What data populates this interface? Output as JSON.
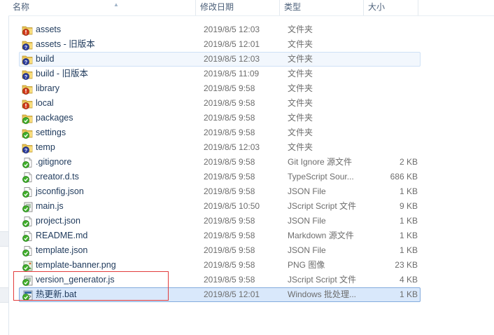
{
  "columns": {
    "name": "名称",
    "date": "修改日期",
    "type": "类型",
    "size": "大小"
  },
  "colors": {
    "selected_bg": "#d9e8fb",
    "annotation": "#e23c3c",
    "git_ok": "#3fae2a",
    "git_modified": "#d23a1a",
    "git_unknown": "#2c3c9c"
  },
  "files": [
    {
      "name": "assets",
      "date": "2019/8/5 12:03",
      "type": "文件夹",
      "size": "",
      "icon": "folder-modified-icon"
    },
    {
      "name": "assets - 旧版本",
      "date": "2019/8/5 12:01",
      "type": "文件夹",
      "size": "",
      "icon": "folder-unversioned-icon"
    },
    {
      "name": "build",
      "date": "2019/8/5 12:03",
      "type": "文件夹",
      "size": "",
      "icon": "folder-unversioned-icon"
    },
    {
      "name": "build - 旧版本",
      "date": "2019/8/5 11:09",
      "type": "文件夹",
      "size": "",
      "icon": "folder-unversioned-icon"
    },
    {
      "name": "library",
      "date": "2019/8/5 9:58",
      "type": "文件夹",
      "size": "",
      "icon": "folder-modified-icon"
    },
    {
      "name": "local",
      "date": "2019/8/5 9:58",
      "type": "文件夹",
      "size": "",
      "icon": "folder-modified-icon"
    },
    {
      "name": "packages",
      "date": "2019/8/5 9:58",
      "type": "文件夹",
      "size": "",
      "icon": "folder-normal-icon"
    },
    {
      "name": "settings",
      "date": "2019/8/5 9:58",
      "type": "文件夹",
      "size": "",
      "icon": "folder-normal-icon"
    },
    {
      "name": "temp",
      "date": "2019/8/5 12:03",
      "type": "文件夹",
      "size": "",
      "icon": "folder-unversioned-icon"
    },
    {
      "name": ".gitignore",
      "date": "2019/8/5 9:58",
      "type": "Git Ignore 源文件",
      "size": "2 KB",
      "icon": "file-normal-icon"
    },
    {
      "name": "creator.d.ts",
      "date": "2019/8/5 9:58",
      "type": "TypeScript Sour...",
      "size": "686 KB",
      "icon": "file-normal-icon"
    },
    {
      "name": "jsconfig.json",
      "date": "2019/8/5 9:58",
      "type": "JSON File",
      "size": "1 KB",
      "icon": "file-normal-icon"
    },
    {
      "name": "main.js",
      "date": "2019/8/5 10:50",
      "type": "JScript Script 文件",
      "size": "9 KB",
      "icon": "script-normal-icon"
    },
    {
      "name": "project.json",
      "date": "2019/8/5 9:58",
      "type": "JSON File",
      "size": "1 KB",
      "icon": "file-normal-icon"
    },
    {
      "name": "README.md",
      "date": "2019/8/5 9:58",
      "type": "Markdown 源文件",
      "size": "1 KB",
      "icon": "file-normal-icon"
    },
    {
      "name": "template.json",
      "date": "2019/8/5 9:58",
      "type": "JSON File",
      "size": "1 KB",
      "icon": "file-normal-icon"
    },
    {
      "name": "template-banner.png",
      "date": "2019/8/5 9:58",
      "type": "PNG 图像",
      "size": "23 KB",
      "icon": "image-normal-icon"
    },
    {
      "name": "version_generator.js",
      "date": "2019/8/5 9:58",
      "type": "JScript Script 文件",
      "size": "4 KB",
      "icon": "script-normal-icon"
    },
    {
      "name": "热更新.bat",
      "date": "2019/8/5 12:01",
      "type": "Windows 批处理...",
      "size": "1 KB",
      "icon": "batch-normal-icon"
    }
  ],
  "hover_index": 2,
  "selected_index": 18
}
